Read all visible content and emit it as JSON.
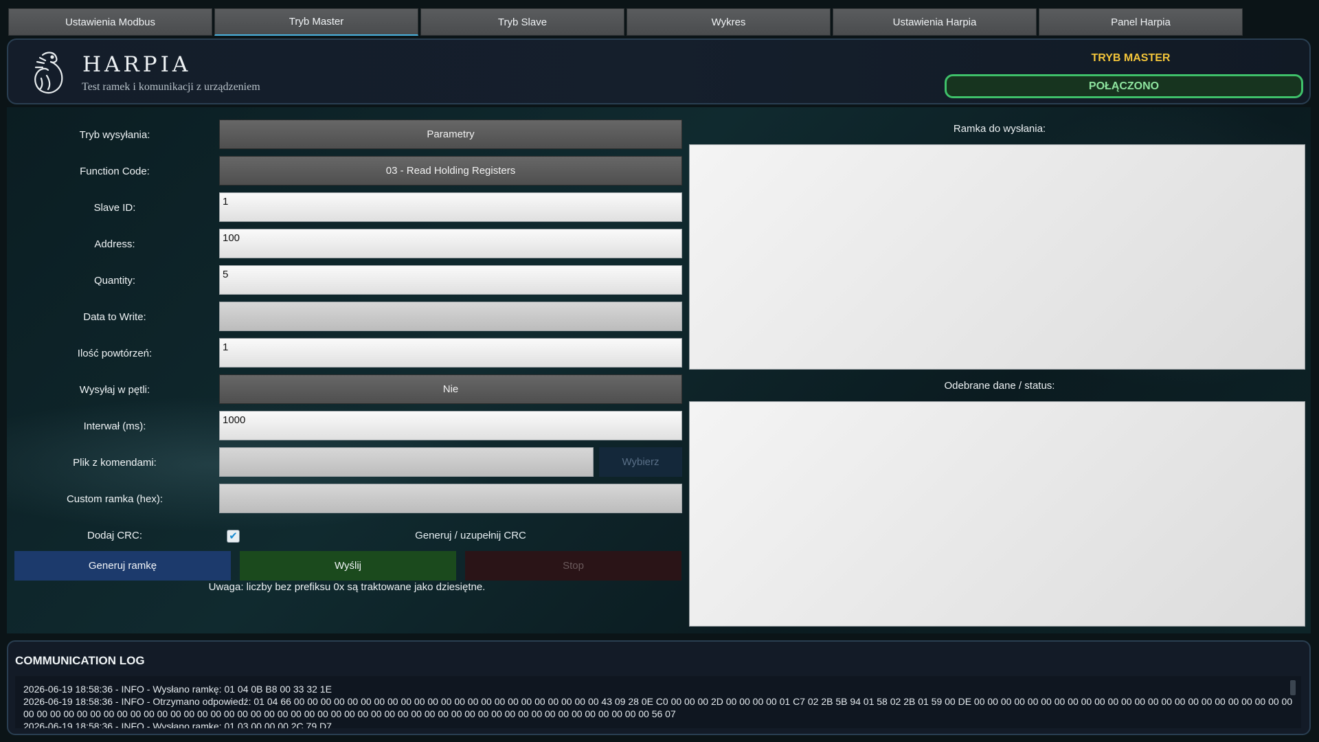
{
  "tabs": [
    {
      "label": "Ustawienia Modbus"
    },
    {
      "label": "Tryb Master"
    },
    {
      "label": "Tryb Slave"
    },
    {
      "label": "Wykres"
    },
    {
      "label": "Ustawienia Harpia"
    },
    {
      "label": "Panel Harpia"
    }
  ],
  "active_tab": "Tryb Master",
  "header": {
    "brand": "HARPIA",
    "subtitle": "Test ramek i komunikacji z urządzeniem",
    "mode": "TRYB MASTER",
    "status": "POŁĄCZONO"
  },
  "colors": {
    "accent_yellow": "#f3c53a",
    "status_green": "#3fc16a",
    "generate_blue": "#1c3a6c",
    "send_green": "#1b4a1d"
  },
  "form": {
    "send_mode": {
      "label": "Tryb wysyłania:",
      "value": "Parametry"
    },
    "function_code": {
      "label": "Function Code:",
      "value": "03 - Read Holding Registers"
    },
    "slave_id": {
      "label": "Slave ID:",
      "value": "1"
    },
    "address": {
      "label": "Address:",
      "value": "100"
    },
    "quantity": {
      "label": "Quantity:",
      "value": "5"
    },
    "data_to_write": {
      "label": "Data to Write:",
      "value": ""
    },
    "repeat_count": {
      "label": "Ilość powtórzeń:",
      "value": "1"
    },
    "loop": {
      "label": "Wysyłaj w pętli:",
      "value": "Nie"
    },
    "interval": {
      "label": "Interwał (ms):",
      "value": "1000"
    },
    "command_file": {
      "label": "Plik z komendami:",
      "value": "",
      "button": "Wybierz"
    },
    "custom_frame": {
      "label": "Custom ramka (hex):",
      "value": ""
    },
    "add_crc": {
      "label": "Dodaj CRC:",
      "checked": true,
      "button": "Generuj / uzupełnij CRC"
    }
  },
  "buttons": {
    "generate": "Generuj ramkę",
    "send": "Wyślij",
    "stop": "Stop"
  },
  "note": "Uwaga: liczby bez prefiksu 0x są traktowane jako dziesiętne.",
  "frame_panel": {
    "title": "Ramka do wysłania:",
    "content": ""
  },
  "received_panel": {
    "title": "Odebrane dane / status:",
    "content": ""
  },
  "log": {
    "title": "COMMUNICATION LOG",
    "lines": [
      "2026-06-19 18:58:36 - INFO - Wysłano ramkę: 01 04 0B B8 00 33 32 1E",
      "2026-06-19 18:58:36 - INFO - Otrzymano odpowiedź: 01 04 66 00 00 00 00 00 00 00 00 00 00 00 00 00 00 00 00 00 00 00 00 00 00 00 43 09 28 0E C0 00 00 00 2D 00 00 00 00 01 C7 02 2B 5B 94 01 58 02 2B 01 59 00 DE 00 00 00 00 00 00 00 00 00 00 00 00 00 00 00 00 00 00 00 00 00 00 00 00 00 00 00 00 00 00 00 00 00 00 00 00 00 00 00 00 00 00 00 00 00 00 00 00 00 00 00 00 00 00 00 00 00 00 00 00 00 00 00 00 00 00 00 00 00 00 00 56 07",
      "2026-06-19 18:58:36 - INFO - Wysłano ramkę: 01 03 00 00 00 2C 79 D7"
    ]
  }
}
